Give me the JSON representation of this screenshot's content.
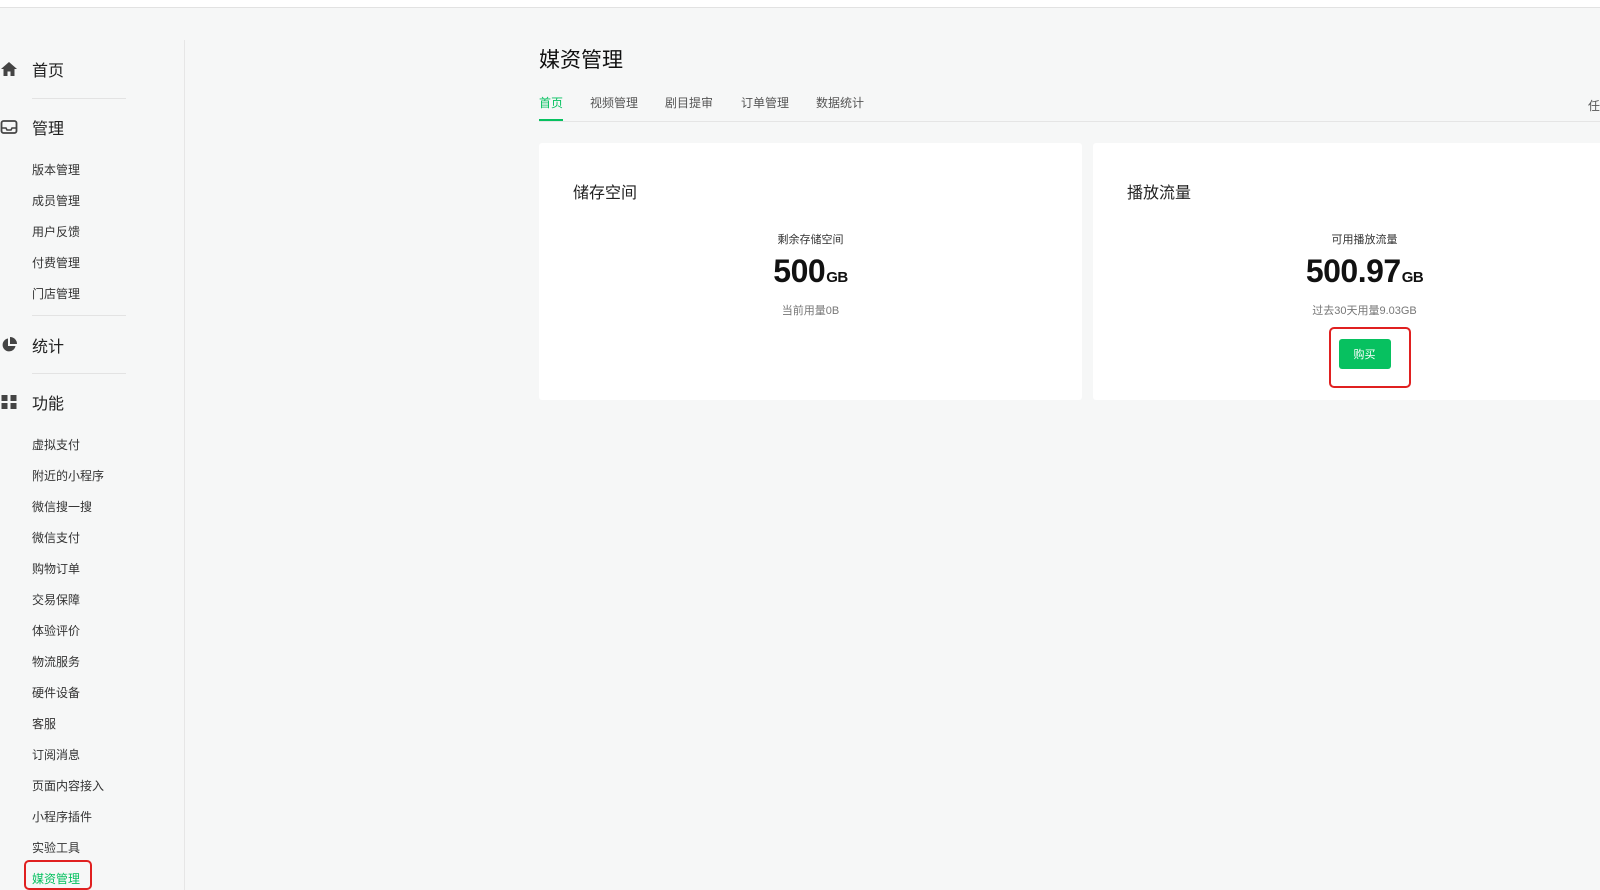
{
  "sidebar": {
    "groups": [
      {
        "label": "首页",
        "icon": "home-icon"
      },
      {
        "label": "管理",
        "icon": "inbox-icon",
        "items": [
          "版本管理",
          "成员管理",
          "用户反馈",
          "付费管理",
          "门店管理"
        ]
      },
      {
        "label": "统计",
        "icon": "pie-chart-icon"
      },
      {
        "label": "功能",
        "icon": "grid-icon",
        "items": [
          "虚拟支付",
          "附近的小程序",
          "微信搜一搜",
          "微信支付",
          "购物订单",
          "交易保障",
          "体验评价",
          "物流服务",
          "硬件设备",
          "客服",
          "订阅消息",
          "页面内容接入",
          "小程序插件",
          "实验工具",
          "媒资管理"
        ]
      }
    ],
    "active_item": "媒资管理"
  },
  "main": {
    "title": "媒资管理",
    "tabs": [
      {
        "label": "首页",
        "active": true
      },
      {
        "label": "视频管理",
        "active": false
      },
      {
        "label": "剧目提审",
        "active": false
      },
      {
        "label": "订单管理",
        "active": false
      },
      {
        "label": "数据统计",
        "active": false
      }
    ],
    "tab_right_partial": "任",
    "storage_card": {
      "title": "储存空间",
      "metric_label": "剩余存储空间",
      "value": "500",
      "unit": "GB",
      "sub": "当前用量0B"
    },
    "traffic_card": {
      "title": "播放流量",
      "metric_label": "可用播放流量",
      "value": "500.97",
      "unit": "GB",
      "sub": "过去30天用量9.03GB",
      "buy_label": "购买"
    }
  },
  "colors": {
    "accent": "#07c160",
    "highlight": "#e02020",
    "background": "#f6f7f7"
  }
}
